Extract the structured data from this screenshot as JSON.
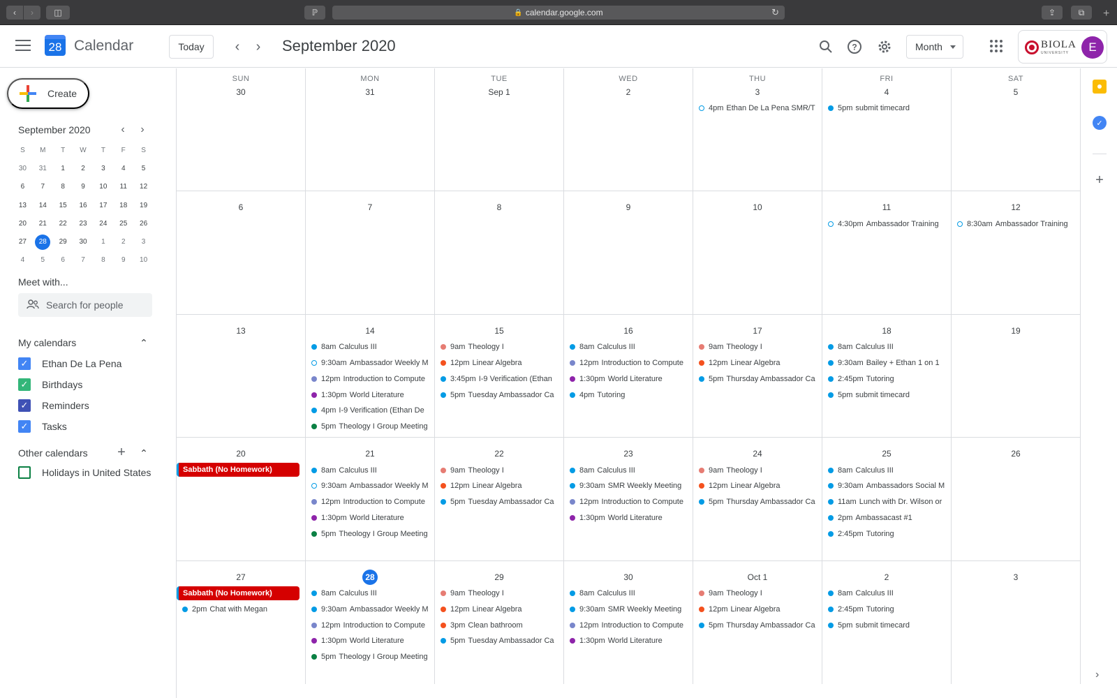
{
  "browser": {
    "url": "calendar.google.com"
  },
  "header": {
    "app_name": "Calendar",
    "logo_day": "28",
    "today_label": "Today",
    "period": "September 2020",
    "view": "Month",
    "org_name": "BIOLA",
    "org_sub": "UNIVERSITY",
    "avatar_initial": "E"
  },
  "sidebar": {
    "create_label": "Create",
    "mini_title": "September 2020",
    "mini_headers": [
      "S",
      "M",
      "T",
      "W",
      "T",
      "F",
      "S"
    ],
    "mini_weeks": [
      [
        "30",
        "31",
        "1",
        "2",
        "3",
        "4",
        "5"
      ],
      [
        "6",
        "7",
        "8",
        "9",
        "10",
        "11",
        "12"
      ],
      [
        "13",
        "14",
        "15",
        "16",
        "17",
        "18",
        "19"
      ],
      [
        "20",
        "21",
        "22",
        "23",
        "24",
        "25",
        "26"
      ],
      [
        "27",
        "28",
        "29",
        "30",
        "1",
        "2",
        "3"
      ],
      [
        "4",
        "5",
        "6",
        "7",
        "8",
        "9",
        "10"
      ]
    ],
    "meet_title": "Meet with...",
    "people_placeholder": "Search for people",
    "my_calendars_title": "My calendars",
    "my_calendars": [
      {
        "name": "Ethan De La Pena",
        "color": "#4285f4",
        "checked": true
      },
      {
        "name": "Birthdays",
        "color": "#33b679",
        "checked": true
      },
      {
        "name": "Reminders",
        "color": "#3f51b5",
        "checked": true
      },
      {
        "name": "Tasks",
        "color": "#4285f4",
        "checked": true
      }
    ],
    "other_calendars_title": "Other calendars",
    "other_calendars": [
      {
        "name": "Holidays in United States",
        "color": "#0b8043",
        "checked": false
      }
    ]
  },
  "grid": {
    "weekdays": [
      "SUN",
      "MON",
      "TUE",
      "WED",
      "THU",
      "FRI",
      "SAT"
    ],
    "weeks": [
      [
        {
          "day": "30",
          "events": []
        },
        {
          "day": "31",
          "events": []
        },
        {
          "day": "Sep 1",
          "events": []
        },
        {
          "day": "2",
          "events": []
        },
        {
          "day": "3",
          "events": [
            {
              "time": "4pm",
              "title": "Ethan De La Pena SMR/T",
              "color": "#039be5",
              "style": "hollow"
            }
          ]
        },
        {
          "day": "4",
          "events": [
            {
              "time": "5pm",
              "title": "submit timecard",
              "color": "#039be5",
              "style": "dot"
            }
          ]
        },
        {
          "day": "5",
          "events": []
        }
      ],
      [
        {
          "day": "6",
          "events": []
        },
        {
          "day": "7",
          "events": []
        },
        {
          "day": "8",
          "events": []
        },
        {
          "day": "9",
          "events": []
        },
        {
          "day": "10",
          "events": []
        },
        {
          "day": "11",
          "events": [
            {
              "time": "4:30pm",
              "title": "Ambassador Training",
              "color": "#039be5",
              "style": "hollow"
            }
          ]
        },
        {
          "day": "12",
          "events": [
            {
              "time": "8:30am",
              "title": "Ambassador Training",
              "color": "#039be5",
              "style": "hollow"
            }
          ]
        }
      ],
      [
        {
          "day": "13",
          "events": []
        },
        {
          "day": "14",
          "events": [
            {
              "time": "8am",
              "title": "Calculus III",
              "color": "#039be5",
              "style": "dot"
            },
            {
              "time": "9:30am",
              "title": "Ambassador Weekly M",
              "color": "#039be5",
              "style": "hollow"
            },
            {
              "time": "12pm",
              "title": "Introduction to Compute",
              "color": "#7986cb",
              "style": "dot"
            },
            {
              "time": "1:30pm",
              "title": "World Literature",
              "color": "#8e24aa",
              "style": "dot"
            },
            {
              "time": "4pm",
              "title": "I-9 Verification (Ethan De",
              "color": "#039be5",
              "style": "dot"
            },
            {
              "time": "5pm",
              "title": "Theology I Group Meeting",
              "color": "#0b8043",
              "style": "dot"
            }
          ]
        },
        {
          "day": "15",
          "events": [
            {
              "time": "9am",
              "title": "Theology I",
              "color": "#e67c73",
              "style": "dot"
            },
            {
              "time": "12pm",
              "title": "Linear Algebra",
              "color": "#f4511e",
              "style": "dot"
            },
            {
              "time": "3:45pm",
              "title": "I-9 Verification (Ethan",
              "color": "#039be5",
              "style": "dot"
            },
            {
              "time": "5pm",
              "title": "Tuesday Ambassador Ca",
              "color": "#039be5",
              "style": "dot"
            }
          ]
        },
        {
          "day": "16",
          "events": [
            {
              "time": "8am",
              "title": "Calculus III",
              "color": "#039be5",
              "style": "dot"
            },
            {
              "time": "12pm",
              "title": "Introduction to Compute",
              "color": "#7986cb",
              "style": "dot"
            },
            {
              "time": "1:30pm",
              "title": "World Literature",
              "color": "#8e24aa",
              "style": "dot"
            },
            {
              "time": "4pm",
              "title": "Tutoring",
              "color": "#039be5",
              "style": "dot"
            }
          ]
        },
        {
          "day": "17",
          "events": [
            {
              "time": "9am",
              "title": "Theology I",
              "color": "#e67c73",
              "style": "dot"
            },
            {
              "time": "12pm",
              "title": "Linear Algebra",
              "color": "#f4511e",
              "style": "dot"
            },
            {
              "time": "5pm",
              "title": "Thursday Ambassador Ca",
              "color": "#039be5",
              "style": "dot"
            }
          ]
        },
        {
          "day": "18",
          "events": [
            {
              "time": "8am",
              "title": "Calculus III",
              "color": "#039be5",
              "style": "dot"
            },
            {
              "time": "9:30am",
              "title": "Bailey + Ethan 1 on 1",
              "color": "#039be5",
              "style": "dot"
            },
            {
              "time": "2:45pm",
              "title": "Tutoring",
              "color": "#039be5",
              "style": "dot"
            },
            {
              "time": "5pm",
              "title": "submit timecard",
              "color": "#039be5",
              "style": "dot"
            }
          ]
        },
        {
          "day": "19",
          "events": []
        }
      ],
      [
        {
          "day": "20",
          "events": [
            {
              "time": "",
              "title": "Sabbath (No Homework)",
              "color": "#d50000",
              "style": "block"
            }
          ]
        },
        {
          "day": "21",
          "events": [
            {
              "time": "8am",
              "title": "Calculus III",
              "color": "#039be5",
              "style": "dot"
            },
            {
              "time": "9:30am",
              "title": "Ambassador Weekly M",
              "color": "#039be5",
              "style": "hollow"
            },
            {
              "time": "12pm",
              "title": "Introduction to Compute",
              "color": "#7986cb",
              "style": "dot"
            },
            {
              "time": "1:30pm",
              "title": "World Literature",
              "color": "#8e24aa",
              "style": "dot"
            },
            {
              "time": "5pm",
              "title": "Theology I Group Meeting",
              "color": "#0b8043",
              "style": "dot"
            }
          ]
        },
        {
          "day": "22",
          "events": [
            {
              "time": "9am",
              "title": "Theology I",
              "color": "#e67c73",
              "style": "dot"
            },
            {
              "time": "12pm",
              "title": "Linear Algebra",
              "color": "#f4511e",
              "style": "dot"
            },
            {
              "time": "5pm",
              "title": "Tuesday Ambassador Ca",
              "color": "#039be5",
              "style": "dot"
            }
          ]
        },
        {
          "day": "23",
          "events": [
            {
              "time": "8am",
              "title": "Calculus III",
              "color": "#039be5",
              "style": "dot"
            },
            {
              "time": "9:30am",
              "title": "SMR Weekly Meeting",
              "color": "#039be5",
              "style": "dot"
            },
            {
              "time": "12pm",
              "title": "Introduction to Compute",
              "color": "#7986cb",
              "style": "dot"
            },
            {
              "time": "1:30pm",
              "title": "World Literature",
              "color": "#8e24aa",
              "style": "dot"
            }
          ]
        },
        {
          "day": "24",
          "events": [
            {
              "time": "9am",
              "title": "Theology I",
              "color": "#e67c73",
              "style": "dot"
            },
            {
              "time": "12pm",
              "title": "Linear Algebra",
              "color": "#f4511e",
              "style": "dot"
            },
            {
              "time": "5pm",
              "title": "Thursday Ambassador Ca",
              "color": "#039be5",
              "style": "dot"
            }
          ]
        },
        {
          "day": "25",
          "events": [
            {
              "time": "8am",
              "title": "Calculus III",
              "color": "#039be5",
              "style": "dot"
            },
            {
              "time": "9:30am",
              "title": "Ambassadors Social M",
              "color": "#039be5",
              "style": "dot"
            },
            {
              "time": "11am",
              "title": "Lunch with Dr. Wilson or",
              "color": "#039be5",
              "style": "dot"
            },
            {
              "time": "2pm",
              "title": "Ambassacast #1",
              "color": "#039be5",
              "style": "dot"
            },
            {
              "time": "2:45pm",
              "title": "Tutoring",
              "color": "#039be5",
              "style": "dot"
            }
          ]
        },
        {
          "day": "26",
          "events": []
        }
      ],
      [
        {
          "day": "27",
          "events": [
            {
              "time": "",
              "title": "Sabbath (No Homework)",
              "color": "#d50000",
              "style": "block"
            },
            {
              "time": "2pm",
              "title": "Chat with Megan",
              "color": "#039be5",
              "style": "dot"
            }
          ]
        },
        {
          "day": "28",
          "today": true,
          "events": [
            {
              "time": "8am",
              "title": "Calculus III",
              "color": "#039be5",
              "style": "dot"
            },
            {
              "time": "9:30am",
              "title": "Ambassador Weekly M",
              "color": "#039be5",
              "style": "dot"
            },
            {
              "time": "12pm",
              "title": "Introduction to Compute",
              "color": "#7986cb",
              "style": "dot"
            },
            {
              "time": "1:30pm",
              "title": "World Literature",
              "color": "#8e24aa",
              "style": "dot"
            },
            {
              "time": "5pm",
              "title": "Theology I Group Meeting",
              "color": "#0b8043",
              "style": "dot"
            }
          ]
        },
        {
          "day": "29",
          "events": [
            {
              "time": "9am",
              "title": "Theology I",
              "color": "#e67c73",
              "style": "dot"
            },
            {
              "time": "12pm",
              "title": "Linear Algebra",
              "color": "#f4511e",
              "style": "dot"
            },
            {
              "time": "3pm",
              "title": "Clean bathroom",
              "color": "#f4511e",
              "style": "dot"
            },
            {
              "time": "5pm",
              "title": "Tuesday Ambassador Ca",
              "color": "#039be5",
              "style": "dot"
            }
          ]
        },
        {
          "day": "30",
          "events": [
            {
              "time": "8am",
              "title": "Calculus III",
              "color": "#039be5",
              "style": "dot"
            },
            {
              "time": "9:30am",
              "title": "SMR Weekly Meeting",
              "color": "#039be5",
              "style": "dot"
            },
            {
              "time": "12pm",
              "title": "Introduction to Compute",
              "color": "#7986cb",
              "style": "dot"
            },
            {
              "time": "1:30pm",
              "title": "World Literature",
              "color": "#8e24aa",
              "style": "dot"
            }
          ]
        },
        {
          "day": "Oct 1",
          "events": [
            {
              "time": "9am",
              "title": "Theology I",
              "color": "#e67c73",
              "style": "dot"
            },
            {
              "time": "12pm",
              "title": "Linear Algebra",
              "color": "#f4511e",
              "style": "dot"
            },
            {
              "time": "5pm",
              "title": "Thursday Ambassador Ca",
              "color": "#039be5",
              "style": "dot"
            }
          ]
        },
        {
          "day": "2",
          "events": [
            {
              "time": "8am",
              "title": "Calculus III",
              "color": "#039be5",
              "style": "dot"
            },
            {
              "time": "2:45pm",
              "title": "Tutoring",
              "color": "#039be5",
              "style": "dot"
            },
            {
              "time": "5pm",
              "title": "submit timecard",
              "color": "#039be5",
              "style": "dot"
            }
          ]
        },
        {
          "day": "3",
          "events": []
        }
      ]
    ]
  }
}
